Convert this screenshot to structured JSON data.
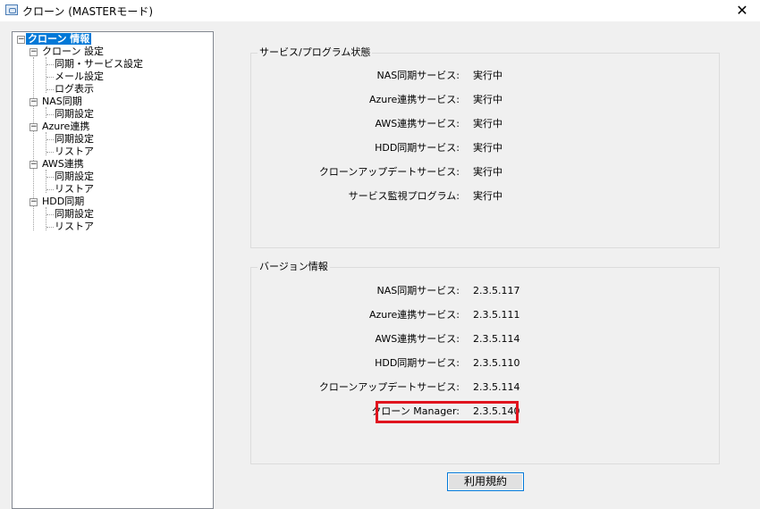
{
  "window": {
    "title": "クローン (MASTERモード)",
    "close_glyph": "✕"
  },
  "tree": {
    "root": "クローン 情報",
    "clone_settings": {
      "label": "クローン 設定",
      "children": [
        "同期・サービス設定",
        "メール設定",
        "ログ表示"
      ]
    },
    "nas": {
      "label": "NAS同期",
      "children": [
        "同期設定"
      ]
    },
    "azure": {
      "label": "Azure連携",
      "children": [
        "同期設定",
        "リストア"
      ]
    },
    "aws": {
      "label": "AWS連携",
      "children": [
        "同期設定",
        "リストア"
      ]
    },
    "hdd": {
      "label": "HDD同期",
      "children": [
        "同期設定",
        "リストア"
      ]
    }
  },
  "service_status": {
    "title": "サービス/プログラム状態",
    "rows": [
      {
        "name": "NAS同期サービス:",
        "value": "実行中"
      },
      {
        "name": "Azure連携サービス:",
        "value": "実行中"
      },
      {
        "name": "AWS連携サービス:",
        "value": "実行中"
      },
      {
        "name": "HDD同期サービス:",
        "value": "実行中"
      },
      {
        "name": "クローンアップデートサービス:",
        "value": "実行中"
      },
      {
        "name": "サービス監視プログラム:",
        "value": "実行中"
      }
    ]
  },
  "version_info": {
    "title": "バージョン情報",
    "rows": [
      {
        "name": "NAS同期サービス:",
        "value": "2.3.5.117"
      },
      {
        "name": "Azure連携サービス:",
        "value": "2.3.5.111"
      },
      {
        "name": "AWS連携サービス:",
        "value": "2.3.5.114"
      },
      {
        "name": "HDD同期サービス:",
        "value": "2.3.5.110"
      },
      {
        "name": "クローンアップデートサービス:",
        "value": "2.3.5.114"
      },
      {
        "name": "クローン Manager:",
        "value": "2.3.5.140"
      }
    ]
  },
  "terms_button": "利用規約",
  "colors": {
    "highlight": "#e0141e",
    "selection": "#0078d7"
  }
}
